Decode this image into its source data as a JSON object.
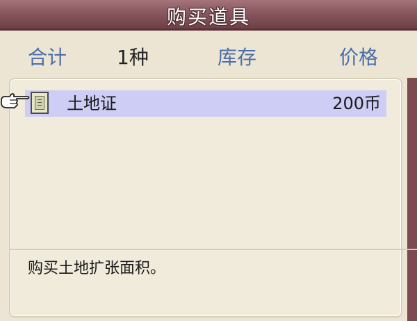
{
  "window": {
    "title": "购买道具"
  },
  "header": {
    "total_label": "合计",
    "total_value": "1种",
    "stock_label": "库存",
    "price_label": "价格"
  },
  "items": [
    {
      "name": "土地证",
      "price": "200币",
      "icon": "land-deed-icon",
      "selected": true
    }
  ],
  "description": "购买土地扩张面积。",
  "colors": {
    "title_bar": "#8a5a60",
    "header_blue": "#4a6fa8",
    "selection": "#cdcdf5",
    "panel_bg": "#f1ebdc"
  }
}
